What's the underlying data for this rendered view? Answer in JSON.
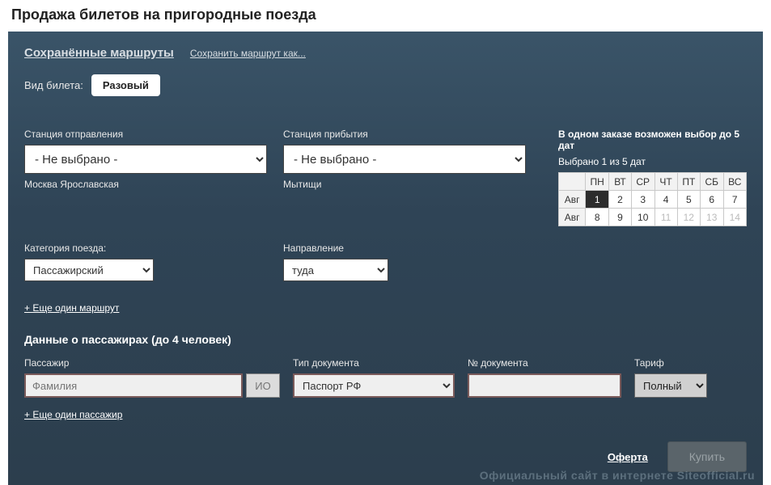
{
  "page": {
    "title": "Продажа билетов на пригородные поезда"
  },
  "top": {
    "saved_routes": "Сохранённые маршруты",
    "save_as": "Сохранить маршрут как..."
  },
  "ticket_type": {
    "label": "Вид билета:",
    "value": "Разовый"
  },
  "departure": {
    "label": "Станция отправления",
    "selected": "- Не выбрано -",
    "hint": "Москва Ярославская"
  },
  "arrival": {
    "label": "Станция прибытия",
    "selected": "- Не выбрано -",
    "hint": "Мытищи"
  },
  "category": {
    "label": "Категория поезда:",
    "selected": "Пассажирский"
  },
  "direction": {
    "label": "Направление",
    "selected": "туда"
  },
  "add_route": "+ Еще один маршрут",
  "calendar": {
    "info": "В одном заказе возможен выбор до 5 дат",
    "selected_text": "Выбрано 1 из 5 дат",
    "dow": [
      "ПН",
      "ВТ",
      "СР",
      "ЧТ",
      "ПТ",
      "СБ",
      "ВС"
    ],
    "month": "Авг",
    "rows": [
      {
        "days": [
          1,
          2,
          3,
          4,
          5,
          6,
          7
        ],
        "selected": 1,
        "disabled": []
      },
      {
        "days": [
          8,
          9,
          10,
          11,
          12,
          13,
          14
        ],
        "selected": null,
        "disabled": [
          11,
          12,
          13,
          14
        ]
      }
    ]
  },
  "passengers": {
    "title": "Данные о пассажирах (до 4 человек)",
    "col_passenger": "Пассажир",
    "col_doc_type": "Тип документа",
    "col_doc_no": "№ документа",
    "col_tariff": "Тариф",
    "surname_placeholder": "Фамилия",
    "io_placeholder": "ИО",
    "doc_type": "Паспорт РФ",
    "tariff": "Полный",
    "add": "+ Еще один пассажир"
  },
  "footer": {
    "offer": "Оферта",
    "buy": "Купить"
  },
  "watermark": "Официальный сайт в интернете Siteofficial.ru"
}
